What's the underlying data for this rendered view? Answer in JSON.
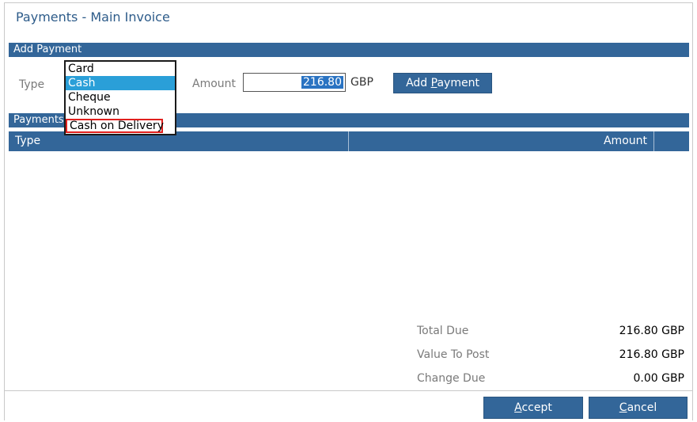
{
  "title": "Payments - Main Invoice",
  "add_payment": {
    "section_label": "Add Payment",
    "type_label": "Type",
    "amount_label": "Amount",
    "amount_value": "216.80",
    "currency": "GBP",
    "add_button_prefix": "Add ",
    "add_button_hotkey": "P",
    "add_button_suffix": "ayment"
  },
  "type_dropdown": {
    "options": [
      "Card",
      "Cash",
      "Cheque",
      "Unknown",
      "Cash on Delivery"
    ],
    "selected": "Cash",
    "highlighted": "Cash on Delivery"
  },
  "payments": {
    "section_label": "Payments",
    "columns": [
      "Type",
      "Amount"
    ],
    "rows": []
  },
  "summary": {
    "total_due_label": "Total Due",
    "total_due_value": "216.80 GBP",
    "value_to_post_label": "Value To Post",
    "value_to_post_value": "216.80 GBP",
    "change_due_label": "Change Due",
    "change_due_value": "0.00 GBP"
  },
  "footer": {
    "accept_hotkey": "A",
    "accept_rest": "ccept",
    "cancel_hotkey": "C",
    "cancel_rest": "ancel"
  },
  "colors": {
    "accent": "#336699",
    "title": "#2e5c8a",
    "selected_option": "#2a9fd8",
    "highlight_outline": "#e0201e"
  }
}
